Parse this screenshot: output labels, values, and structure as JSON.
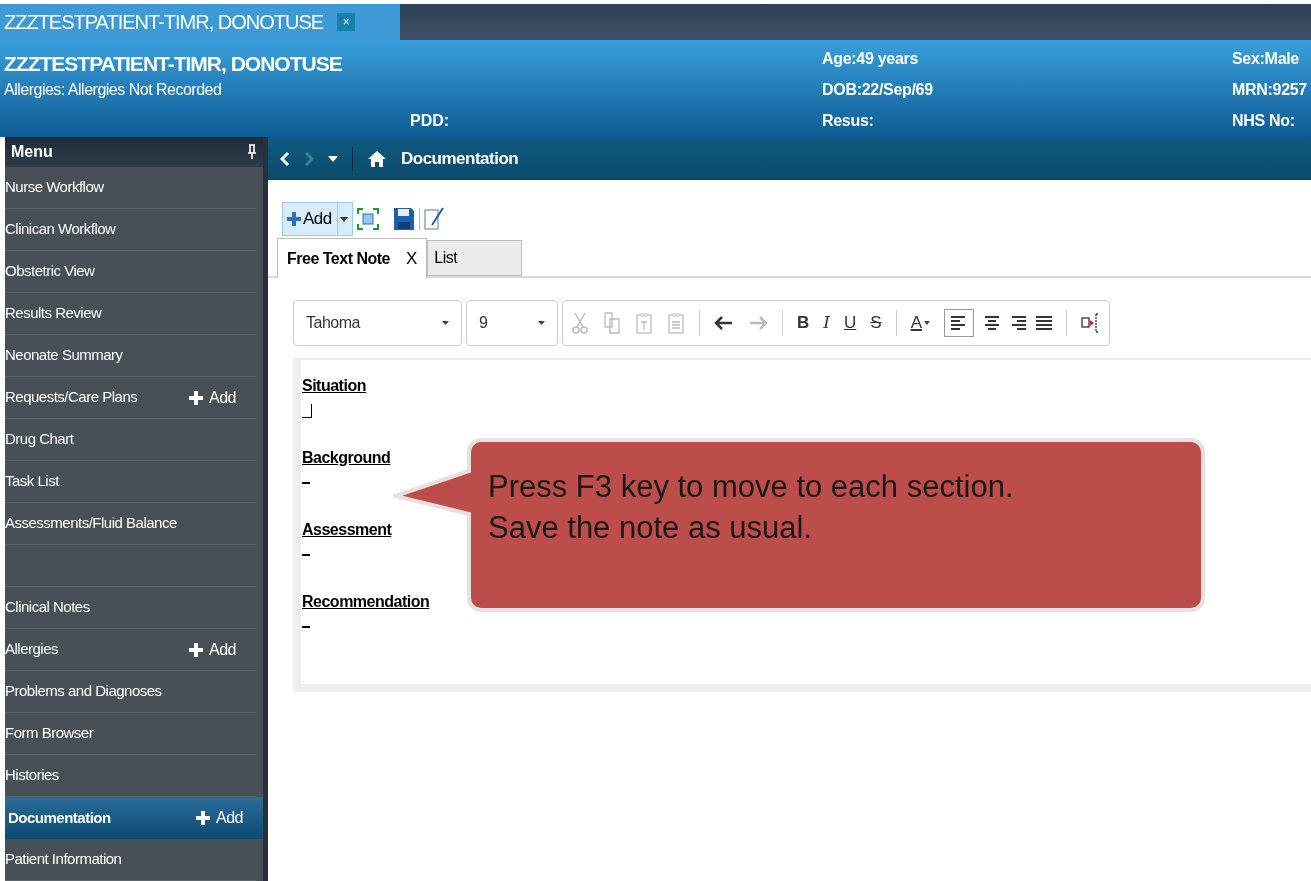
{
  "patient_tab": {
    "title": "ZZZTESTPATIENT-TIMR, DONOTUSE",
    "close": "×"
  },
  "banner": {
    "name": "ZZZTESTPATIENT-TIMR, DONOTUSE",
    "allergies": "Allergies: Allergies Not Recorded",
    "pdd": "PDD:",
    "column_1": [
      "Age:49 years",
      "DOB:22/Sep/69",
      "Resus:"
    ],
    "column_2": [
      "Sex:Male",
      "MRN:9257",
      "NHS No:"
    ]
  },
  "menu": {
    "title": "Menu",
    "items": [
      {
        "label": "Nurse Workflow",
        "selected": false
      },
      {
        "label": "Clinican Workflow",
        "selected": false
      },
      {
        "label": "Obstetric View",
        "selected": false
      },
      {
        "label": "Results Review",
        "selected": false
      },
      {
        "label": "Neonate Summary",
        "selected": false
      },
      {
        "label": "Requests/Care Plans",
        "selected": false,
        "add": "Add"
      },
      {
        "label": "Drug Chart",
        "selected": false
      },
      {
        "label": "Task List",
        "selected": false
      },
      {
        "label": "Assessments/Fluid Balance",
        "selected": false
      },
      {
        "label": "Clinical Notes",
        "selected": false,
        "gap_before": true
      },
      {
        "label": "Allergies",
        "selected": false,
        "add": "Add"
      },
      {
        "label": "Problems and Diagnoses",
        "selected": false
      },
      {
        "label": "Form Browser",
        "selected": false
      },
      {
        "label": "Histories",
        "selected": false
      },
      {
        "label": "Documentation",
        "selected": true,
        "add": "Add"
      },
      {
        "label": "Patient Information",
        "selected": false
      }
    ]
  },
  "nav": {
    "title": "Documentation"
  },
  "toolbar": {
    "add": "Add"
  },
  "note_tabs": [
    {
      "label": "Free Text Note",
      "selected": true,
      "close": "X"
    },
    {
      "label": "List",
      "selected": false
    }
  ],
  "format_bar": {
    "font": "Tahoma",
    "size": "9",
    "bold": "B",
    "italic": "I",
    "underline": "U",
    "strike": "S",
    "font_color": "A"
  },
  "note": {
    "sections": [
      {
        "heading": "Situation"
      },
      {
        "heading": "Background"
      },
      {
        "heading": "Assessment"
      },
      {
        "heading": "Recommendation"
      }
    ]
  },
  "callout": {
    "lines": [
      "Press F3 key to move to each section.",
      "Save the note as usual."
    ]
  }
}
